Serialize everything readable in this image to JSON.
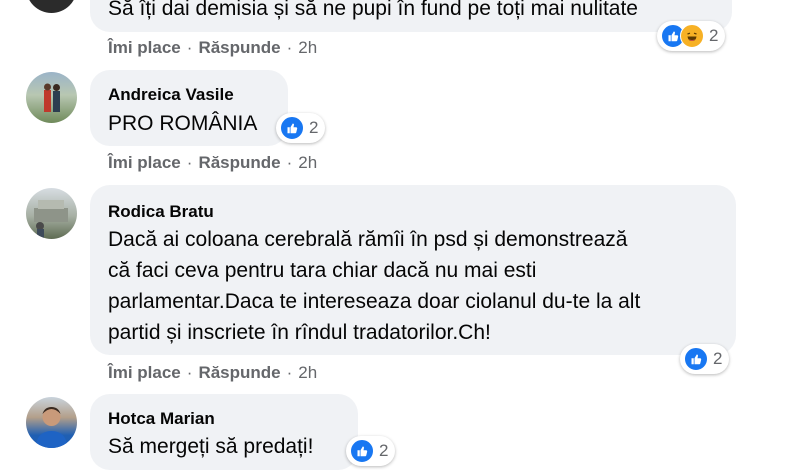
{
  "colors": {
    "bubble_bg": "#f0f2f5",
    "like_blue": "#1877f2",
    "haha_yellow": "#f7b125",
    "meta_gray": "#65676b"
  },
  "labels": {
    "like": "Îmi place",
    "reply": "Răspunde",
    "separator": "·"
  },
  "comments": [
    {
      "author": "",
      "lines": [
        "Să îți dai demisia și să ne pupi în fund pe toți mai nulitate"
      ],
      "time": "2h",
      "reactions": {
        "icons": [
          "like-icon",
          "haha-icon"
        ],
        "count": "2"
      }
    },
    {
      "author": "Andreica Vasile",
      "lines": [
        "PRO ROMÂNIA"
      ],
      "time": "2h",
      "reactions": {
        "icons": [
          "like-icon"
        ],
        "count": "2"
      }
    },
    {
      "author": "Rodica Bratu",
      "lines": [
        "Dacă ai coloana cerebrală rămîi în psd și demonstrează",
        "că faci ceva pentru tara chiar dacă nu mai esti",
        "parlamentar.Daca te intereseaza doar ciolanul du-te la alt",
        "partid și inscriete în rîndul tradatorilor.Ch!"
      ],
      "time": "2h",
      "reactions": {
        "icons": [
          "like-icon"
        ],
        "count": "2"
      }
    },
    {
      "author": "Hotca Marian",
      "lines": [
        "Să mergeți să predați!"
      ],
      "time": "",
      "reactions": {
        "icons": [
          "like-icon"
        ],
        "count": "2"
      }
    }
  ]
}
